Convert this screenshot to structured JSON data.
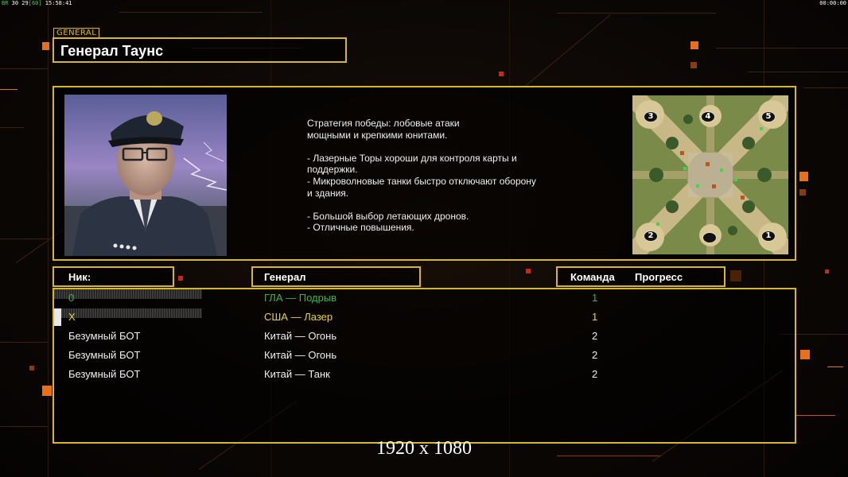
{
  "status": {
    "left_prefix": "BR",
    "left_text": " 30 29",
    "left_fps": "[60]",
    "left_time": " 15:58:41",
    "right_time": "00:00:00"
  },
  "header": {
    "category_tag": "GENERAL",
    "general_name": "Генерал Таунс"
  },
  "info": {
    "description": "Стратегия победы: лобовые атаки\nмощными и крепкими юнитами.\n\n- Лазерные Торы хороши для контроля карты и\n  поддержки.\n- Микроволновые танки быстро отключают оборону\n  и здания.\n\n- Большой выбор летающих дронов.\n- Отличные повышения.",
    "map_markers": [
      "3",
      "4",
      "5",
      "2",
      "",
      "1"
    ]
  },
  "columns": {
    "nick": "Ник:",
    "general": "Генерал",
    "team": "Команда",
    "progress": "Прогресс"
  },
  "players": [
    {
      "nick": "0",
      "general": "ГЛА — Подрыв",
      "team": "1",
      "color": "#3fb83f",
      "progress": 0.0
    },
    {
      "nick": "X",
      "general": "США — Лазер",
      "team": "1",
      "color": "#e8d43a",
      "progress": 0.01
    },
    {
      "nick": "Безумный БОТ",
      "general": "Китай — Огонь",
      "team": "2",
      "color": "#f0f0f0"
    },
    {
      "nick": "Безумный БОТ",
      "general": "Китай — Огонь",
      "team": "2",
      "color": "#f0f0f0"
    },
    {
      "nick": "Безумный БОТ",
      "general": "Китай — Танк",
      "team": "2",
      "color": "#f0f0f0"
    }
  ],
  "watermark": "1920 x 1080",
  "colors": {
    "accent_gold": "#d8b62a",
    "accent_orange": "#e8701a"
  }
}
